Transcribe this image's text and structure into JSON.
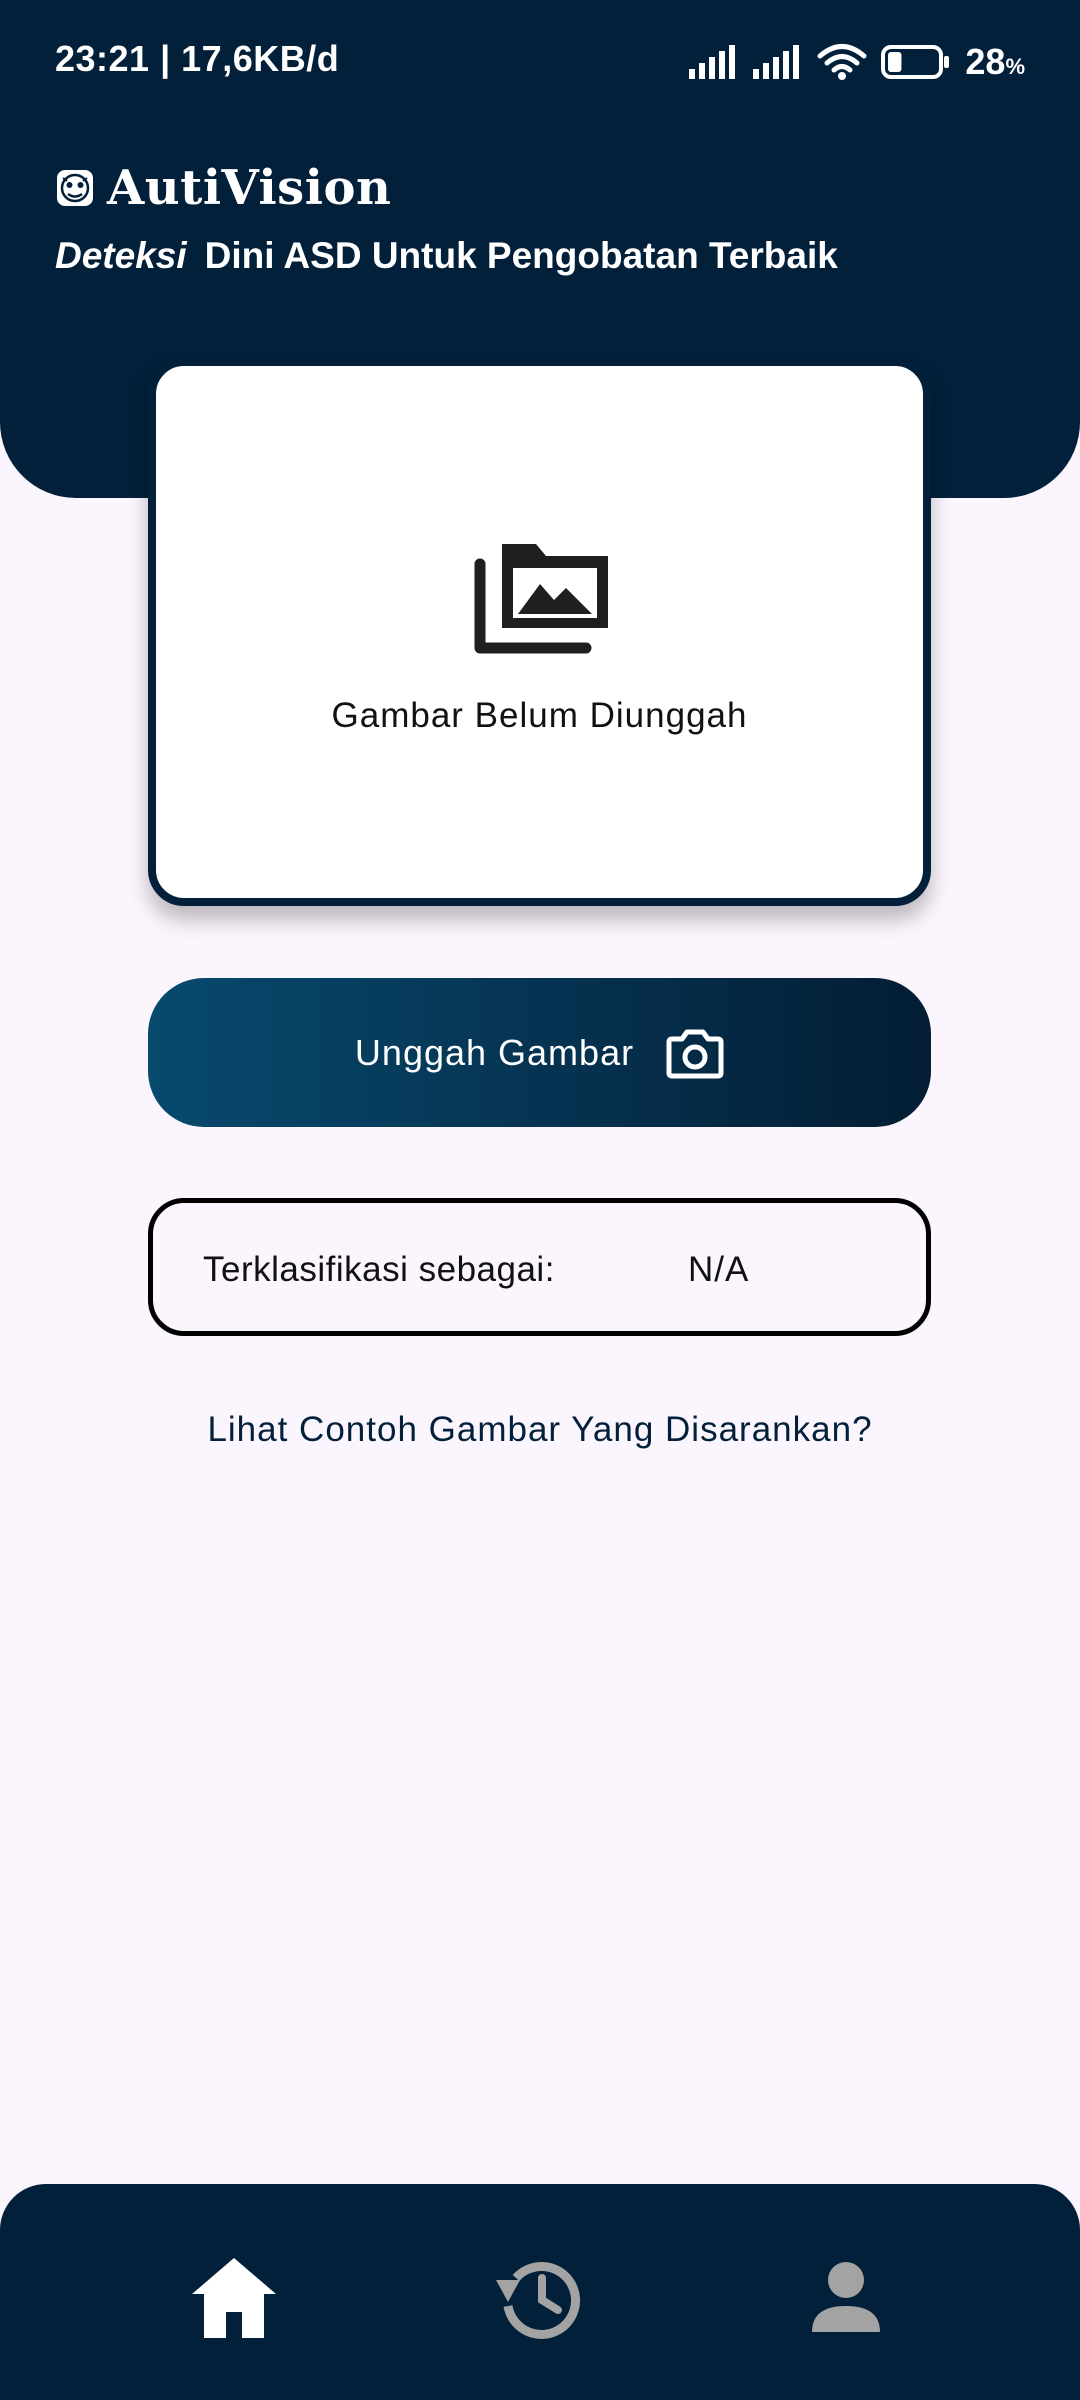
{
  "status_bar": {
    "time_speed": "23:21 | 17,6KB/d",
    "battery_level": "28",
    "battery_unit": "%",
    "battery_fraction": 0.28,
    "icons": [
      "signal-icon",
      "signal-icon",
      "wifi-icon",
      "battery-icon"
    ]
  },
  "header": {
    "app_name": "AutiVision",
    "logo_icon": "autism-logo-icon",
    "tagline_emphasis": "Deteksi",
    "tagline_rest": "Dini ASD Untuk Pengobatan Terbaik"
  },
  "preview": {
    "icon": "image-gallery-icon",
    "placeholder_text": "Gambar Belum Diunggah"
  },
  "upload": {
    "label": "Unggah Gambar",
    "icon": "camera-icon"
  },
  "result": {
    "label": "Terklasifikasi sebagai:",
    "value": "N/A"
  },
  "sample_link": {
    "label": "Lihat Contoh Gambar Yang Disarankan?"
  },
  "bottom_nav": {
    "items": [
      {
        "icon": "home-icon",
        "active": true
      },
      {
        "icon": "history-icon",
        "active": false
      },
      {
        "icon": "profile-icon",
        "active": false
      }
    ]
  },
  "colors": {
    "primary": "#03203a",
    "background": "#fbf5fd",
    "button_gradient_start": "#074a6e",
    "inactive_icon": "#a3a3a3"
  }
}
